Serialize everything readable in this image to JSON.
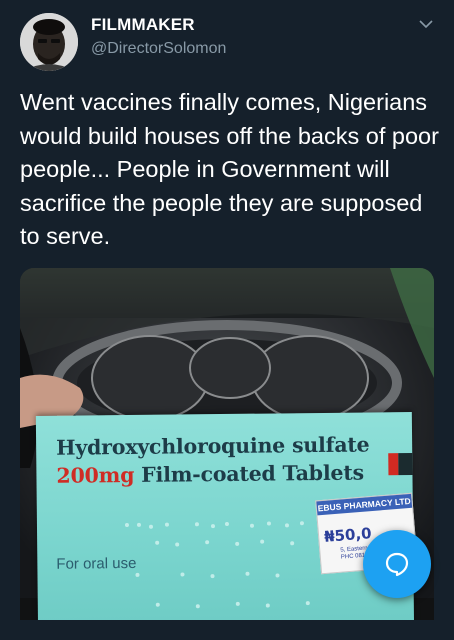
{
  "tweet": {
    "author_name": "FILMMAKER",
    "author_handle": "@DirectorSolomon",
    "text": "Went vaccines finally comes, Nigerians would build houses off the backs of poor people... People in Government will sacrifice the people they are supposed to serve."
  },
  "media": {
    "box_line1": "Hydroxychloroquine sulfate",
    "box_dose": "200mg",
    "box_line2_rest": " Film-coated Tablets",
    "box_oral": "For oral use",
    "sticker_title": "EBUS PHARMACY LTD",
    "sticker_price": "₦50,0",
    "sticker_addr": "5, Eastern By\nPHC 0813",
    "description": "Hand holding a box of Hydroxychloroquine sulfate tablets in a car"
  },
  "icons": {
    "menu": "chevron-down-icon",
    "compose": "reply-bubble-icon"
  },
  "colors": {
    "background": "#15202b",
    "accent": "#1da1f2",
    "secondary_text": "#8899a6"
  }
}
